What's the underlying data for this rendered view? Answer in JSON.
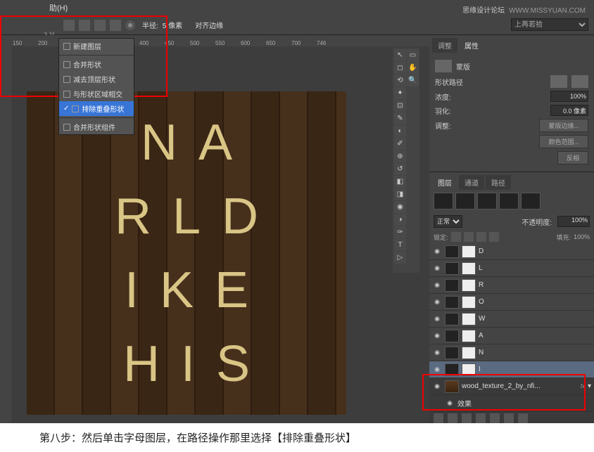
{
  "watermark": {
    "brand": "思缘设计论坛",
    "url": "WWW.MISSYUAN.COM"
  },
  "menubar": {
    "helpLabel": "助(H)"
  },
  "optbar": {
    "radiusLabel": "半径:",
    "radiusValue": "5 像素",
    "alignLabel": "对齐边缘"
  },
  "version": "3.1f",
  "dropdown": {
    "items": [
      {
        "label": "新建图层"
      },
      {
        "label": "合并形状"
      },
      {
        "label": "减去顶层形状"
      },
      {
        "label": "与形状区域相交"
      },
      {
        "label": "排除重叠形状",
        "sel": true
      },
      {
        "label": "合并形状组件",
        "sep": true
      }
    ]
  },
  "canvas": {
    "rows": [
      [
        "N",
        "A"
      ],
      [
        "R",
        "L",
        "D"
      ],
      [
        "I",
        "K",
        "E"
      ],
      [
        "H",
        "I",
        "S"
      ]
    ]
  },
  "prop": {
    "tabs": [
      "调整",
      "属性"
    ],
    "title": "蒙版",
    "pathLabel": "形状路径",
    "densityLabel": "浓度:",
    "densityValue": "100%",
    "featherLabel": "羽化:",
    "featherValue": "0.0 像素",
    "refineLabel": "调整:",
    "btns": [
      "蒙版边缘...",
      "颜色范围...",
      "反相"
    ]
  },
  "layers": {
    "tabs": [
      "图层",
      "通道",
      "路径"
    ],
    "blendLabel": "正常",
    "opacityLabel": "不透明度:",
    "opacityValue": "100%",
    "lockLabel": "锁定:",
    "fillLabel": "填充:",
    "fillValue": "100%",
    "items": [
      {
        "name": "D"
      },
      {
        "name": "L"
      },
      {
        "name": "R"
      },
      {
        "name": "O"
      },
      {
        "name": "W"
      },
      {
        "name": "A"
      },
      {
        "name": "N"
      },
      {
        "name": "I",
        "sel": true
      },
      {
        "name": "wood_texture_2_by_nfi...",
        "bg": true,
        "fx": "fx"
      }
    ],
    "effects": "效果"
  },
  "topSelect": "上再若拾",
  "caption": "第八步：然后单击字母图层，在路径操作那里选择【排除重叠形状】"
}
